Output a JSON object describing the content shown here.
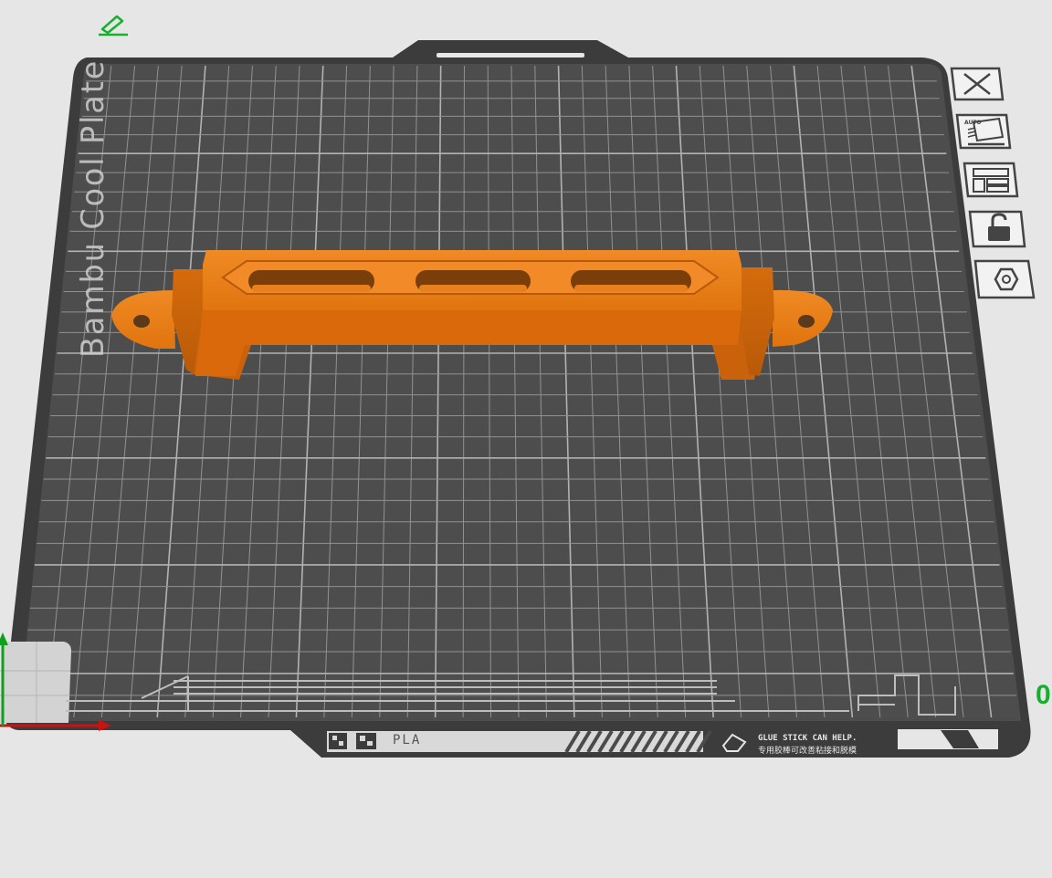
{
  "plate": {
    "name": "Bambu Cool Plate",
    "filament": "PLA",
    "notice_en": "GLUE STICK CAN HELP.",
    "notice_cn": "专用胶棒可改善粘接和脱模"
  },
  "toolbar": {
    "items": [
      {
        "name": "close-plate-button",
        "icon": "close-icon",
        "label": "×"
      },
      {
        "name": "auto-orient-button",
        "icon": "auto-orient-icon",
        "label": "AUTO"
      },
      {
        "name": "arrange-button",
        "icon": "arrange-layout-icon",
        "label": ""
      },
      {
        "name": "lock-plate-button",
        "icon": "unlock-icon",
        "label": ""
      },
      {
        "name": "plate-settings-button",
        "icon": "hexagon-nut-icon",
        "label": ""
      }
    ]
  },
  "axis": {
    "y_label": "0"
  },
  "colors": {
    "background": "#e6e6e6",
    "plate": "#4a4a4a",
    "plate_rim": "#3a3a3a",
    "grid": "#a8a8a8",
    "model": "#e3770f",
    "model_dark": "#b8570a",
    "accent_green": "#15b02e",
    "axis_red": "#d01010"
  }
}
